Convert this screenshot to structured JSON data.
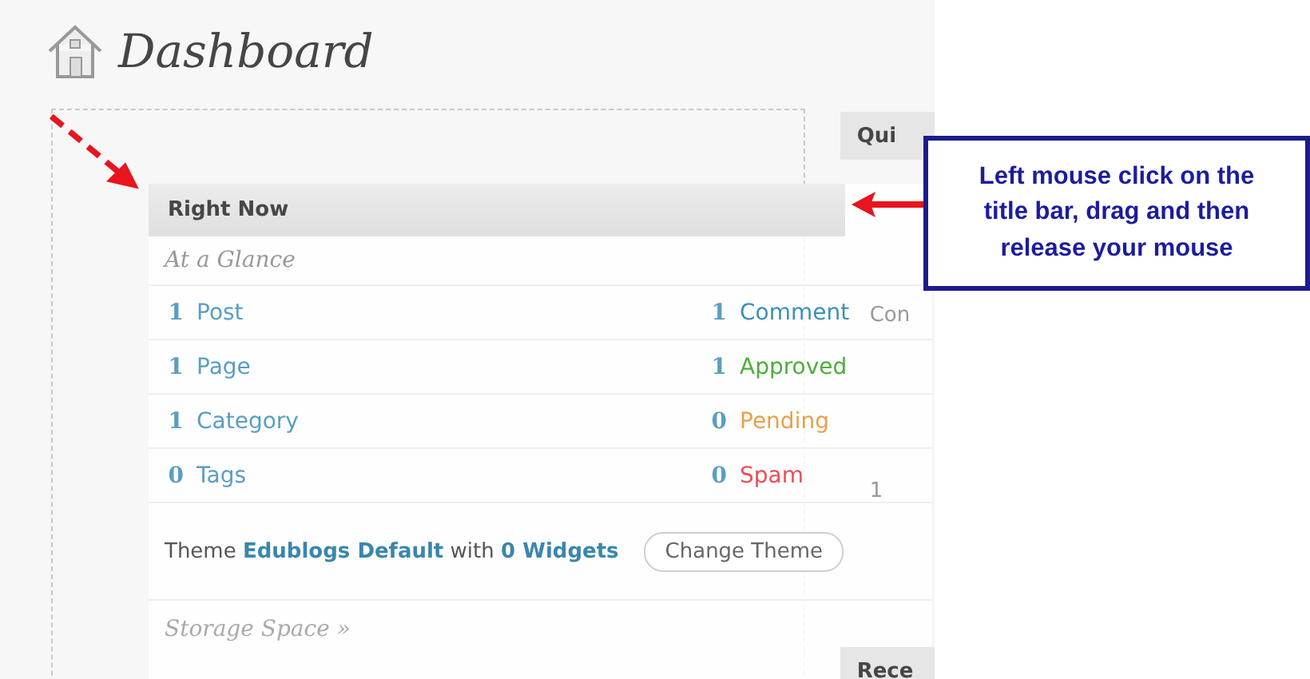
{
  "page": {
    "title": "Dashboard"
  },
  "widget": {
    "title": "Right Now",
    "subtitle": "At a Glance",
    "rows": [
      {
        "left": {
          "count": "1",
          "label": "Post"
        },
        "right": {
          "count": "1",
          "label": "Comment",
          "color": "#3d8fb8"
        }
      },
      {
        "left": {
          "count": "1",
          "label": "Page"
        },
        "right": {
          "count": "1",
          "label": "Approved",
          "color": "#4fae3c"
        }
      },
      {
        "left": {
          "count": "1",
          "label": "Category"
        },
        "right": {
          "count": "0",
          "label": "Pending",
          "color": "#e6a24a"
        }
      },
      {
        "left": {
          "count": "0",
          "label": "Tags"
        },
        "right": {
          "count": "0",
          "label": "Spam",
          "color": "#e8505a"
        }
      }
    ],
    "theme": {
      "prefix": "Theme",
      "name": "Edublogs Default",
      "middle": "with",
      "widgets": "0 Widgets",
      "button": "Change Theme"
    },
    "storage": {
      "link": "Storage Space »"
    }
  },
  "side_column": [
    {
      "kind": "header",
      "text": "Qui"
    },
    {
      "kind": "text",
      "text": "Con"
    },
    {
      "kind": "text",
      "text": "1"
    },
    {
      "kind": "header",
      "text": "Rece"
    }
  ],
  "callout": {
    "text": "Left mouse click on the title bar, drag and then release your mouse"
  }
}
